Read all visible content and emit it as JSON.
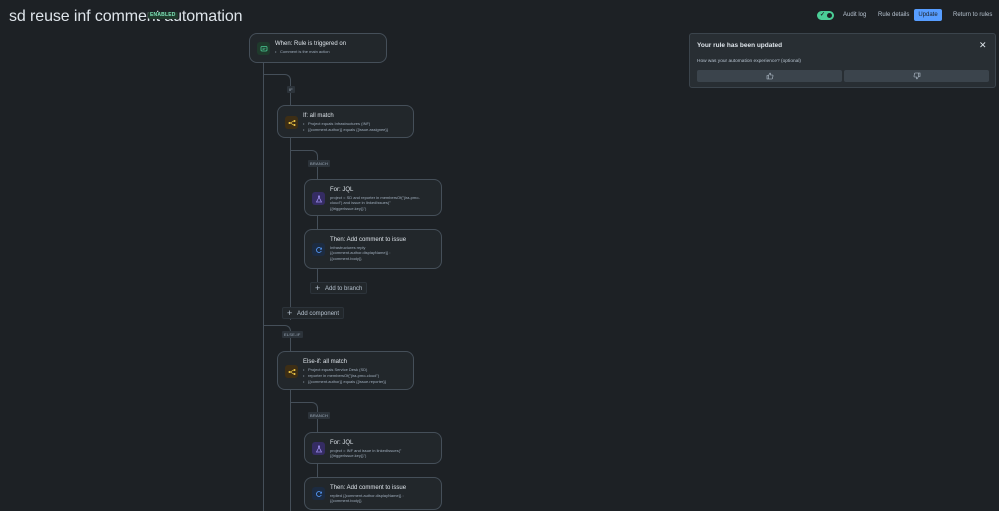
{
  "header": {
    "title": "sd reuse inf comment automation",
    "status_badge": "ENABLED",
    "audit_log": "Audit log",
    "rule_details": "Rule details",
    "update": "Update",
    "return_to_rules": "Return to rules"
  },
  "colors": {
    "background": "#1d2125",
    "accent": "#579dff",
    "enabled": "#4bce97"
  },
  "toast": {
    "title": "Your rule has been updated",
    "question": "How was your automation experience? (optional)",
    "thumbs_up_icon": "thumbs-up-icon",
    "thumbs_down_icon": "thumbs-down-icon"
  },
  "flow": {
    "trigger": {
      "title": "When: Rule is triggered on",
      "items": [
        "Comment is the main action"
      ]
    },
    "if_tag": "IF",
    "if_block": {
      "title": "If: all match",
      "items": [
        "Project equals Infrastructures (INF)",
        "{{comment.author}} equals {{issue.assignee}}"
      ]
    },
    "branch_tag_1": "BRANCH",
    "for_1": {
      "title": "For: JQL",
      "lines": [
        "project = SD and reporter in membersOf(\"jira-pmo-",
        "cloud\") and issue in linkedIssues(\"",
        "{{triggerIssue.key}}\")"
      ]
    },
    "action_1": {
      "title": "Then: Add comment to issue",
      "lines": [
        "Infrastructures reply",
        "{{comment.author.displayName}} :",
        "{{comment.body}}"
      ]
    },
    "add_to_branch": "Add to branch",
    "add_component": "Add component",
    "else_if_tag": "ELSE-IF",
    "else_if_block": {
      "title": "Else-if: all match",
      "items": [
        "Project equals Service Desk (SD)",
        "reporter in membersOf(\"jira-pmo-cloud\")",
        "{{comment.author}} equals {{issue.reporter}}"
      ]
    },
    "branch_tag_2": "BRANCH",
    "for_2": {
      "title": "For: JQL",
      "lines": [
        "project = INF and issue in linkedIssues(\"",
        "{{triggerIssue.key}}\")"
      ]
    },
    "action_2": {
      "title": "Then: Add comment to issue",
      "lines": [
        "replied {{comment.author.displayName}} :",
        "{{comment.body}}"
      ]
    }
  }
}
